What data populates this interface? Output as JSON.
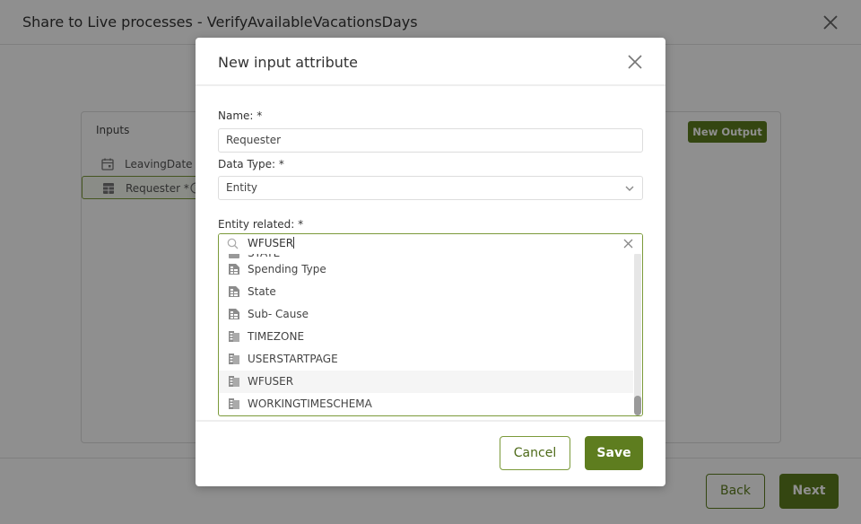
{
  "background_window": {
    "title": "Share to Live processes - VerifyAvailableVacationsDays",
    "close_icon": "close-icon",
    "inputs_panel": {
      "label": "Inputs",
      "items": [
        {
          "label": "LeavingDate *",
          "icon": "calendar-icon"
        },
        {
          "label": "Requester *",
          "icon": "entity-icon",
          "selected": true,
          "info_icon": "info-icon"
        }
      ]
    },
    "new_output_label": "New Output",
    "back_label": "Back",
    "next_label": "Next"
  },
  "modal": {
    "title": "New input attribute",
    "close_icon": "close-icon",
    "name_label": "Name: *",
    "name_value": "Requester",
    "data_type_label": "Data Type: *",
    "data_type_value": "Entity",
    "entity_related_label": "Entity related: *",
    "search_value": "WFUSER",
    "entity_options": [
      {
        "label": "STATE",
        "icon": "entity-icon",
        "partial": true
      },
      {
        "label": "Spending Type",
        "icon": "entity-icon"
      },
      {
        "label": "State",
        "icon": "entity-icon"
      },
      {
        "label": "Sub- Cause",
        "icon": "entity-icon"
      },
      {
        "label": "TIMEZONE",
        "icon": "system-entity-icon"
      },
      {
        "label": "USERSTARTPAGE",
        "icon": "system-entity-icon"
      },
      {
        "label": "WFUSER",
        "icon": "system-entity-icon",
        "hovered": true
      },
      {
        "label": "WORKINGTIMESCHEMA",
        "icon": "system-entity-icon"
      }
    ],
    "cancel_label": "Cancel",
    "save_label": "Save"
  },
  "colors": {
    "accent": "#5e7d1f",
    "accent_border": "#7b9a3a",
    "overlay": "rgba(0,0,0,0.44)"
  }
}
